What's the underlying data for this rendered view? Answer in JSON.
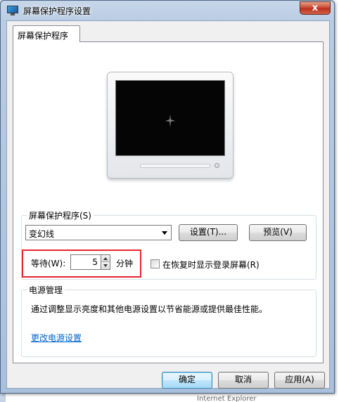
{
  "window": {
    "title": "屏幕保护程序设置",
    "close_label": "x"
  },
  "tab": {
    "label": "屏幕保护程序"
  },
  "screensaver_group": {
    "label": "屏幕保护程序(S)",
    "selected_screensaver": "变幻线",
    "settings_button": "设置(T)...",
    "preview_button": "预览(V)",
    "wait_label": "等待(W):",
    "wait_value": "5",
    "wait_unit": "分钟",
    "resume_checkbox_label": "在恢复时显示登录屏幕(R)",
    "resume_checked": false
  },
  "power_group": {
    "label": "电源管理",
    "description": "通过调整显示亮度和其他电源设置以节省能源或提供最佳性能。",
    "link": "更改电源设置"
  },
  "footer": {
    "ok_button": "确定",
    "cancel_button": "取消",
    "apply_button": "应用(A)"
  },
  "background_text": "Internet Explorer",
  "colors": {
    "highlight": "#e8262b",
    "link": "#0066cc",
    "default_button_border": "#3c7fb1"
  }
}
